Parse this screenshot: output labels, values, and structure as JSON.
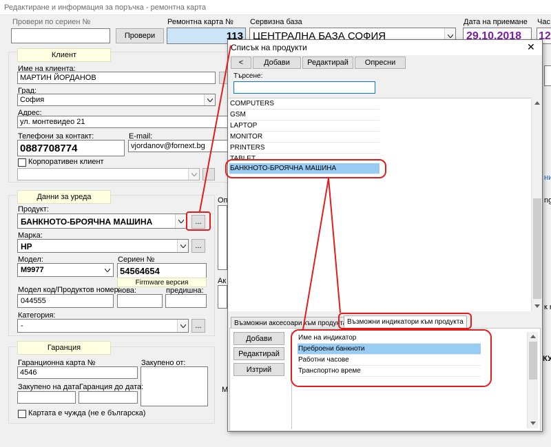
{
  "window": {
    "title": "Редактиране и информация за поръчка - ремонтна карта"
  },
  "top": {
    "serial_check_label": "Провери по сериен №",
    "check_button": "Провери",
    "repair_card_label": "Ремонтна карта №",
    "repair_card_value": "113",
    "service_base_label": "Сервизна база",
    "service_base_value": "ЦЕНТРАЛНА БАЗА СОФИЯ",
    "date_label": "Дата на приемане",
    "date_value": "29.10.2018",
    "hour_label": "Час н",
    "hour_value": "12"
  },
  "client": {
    "section": "Клиент",
    "name_label": "Име на клиента:",
    "name_value": "МАРТИН ЙОРДАНОВ",
    "city_label": "Град:",
    "city_value": "София",
    "address_label": "Адрес:",
    "address_value": "ул. монтевидео 21",
    "phones_label": "Телефони за контакт:",
    "phone_value": "0887708774",
    "email_label": "E-mail:",
    "email_value": "vjordanov@fornext.bg",
    "corporate_label": "Корпоративен клиент"
  },
  "device": {
    "section": "Данни за уреда",
    "product_label": "Продукт:",
    "product_value": "БАНКНОТО-БРОЯЧНА МАШИНА",
    "brand_label": "Марка:",
    "brand_value": "HP",
    "model_label": "Модел:",
    "model_value": "M9977",
    "serial_label": "Сериен №",
    "serial_value": "54564654",
    "firmware_label": "Firmware версия",
    "model_code_label": "Модел код/Продуктов номер:",
    "model_code_value": "044555",
    "new_label": "нова:",
    "prev_label": "предишна:",
    "category_label": "Категория:",
    "category_value": "-",
    "ellipsis": "..."
  },
  "warranty": {
    "section": "Гаранция",
    "card_label": "Гаранционна карта №",
    "card_value": "4546",
    "bought_from_label": "Закупено от:",
    "bought_date_label": "Закупено на дата:",
    "warranty_until_label": "Гаранция до дата:",
    "foreign_card_label": "Картата е чужда (не е българска)"
  },
  "side": {
    "op_label": "Оп",
    "ak_label": "Ак",
    "m_label": "М",
    "nich_label": "нич",
    "ng_label": "ng",
    "k_label": "к кч",
    "ku_label": "КУ"
  },
  "dialog": {
    "title": "Списък на продукти",
    "close": "✕",
    "toolbar": {
      "back": "<",
      "add": "Добави",
      "edit": "Редактирай",
      "refresh": "Опресни"
    },
    "search_label": "Търсене:",
    "search_value": "",
    "products": [
      "COMPUTERS",
      "GSM",
      "LAPTOP",
      "MONITOR",
      "PRINTERS",
      "TABLET",
      "БАНКНОТО-БРОЯЧНА МАШИНА"
    ],
    "selected_product": "БАНКНОТО-БРОЯЧНА МАШИНА",
    "tabs": {
      "accessories": "Възможни аксесоари към продукта",
      "indicators": "Възможни индикатори към продукта"
    },
    "side_buttons": {
      "add": "Добави",
      "edit": "Редактирай",
      "delete": "Изтрий"
    },
    "indicators_header": "Име на индикатор",
    "indicators": [
      "Преброени банкноти",
      "Работни часове",
      "Транспортно време"
    ]
  },
  "colors": {
    "selection": "#99ccf3",
    "annotation": "#e31b1b",
    "section_bg": "#ffffe1"
  }
}
